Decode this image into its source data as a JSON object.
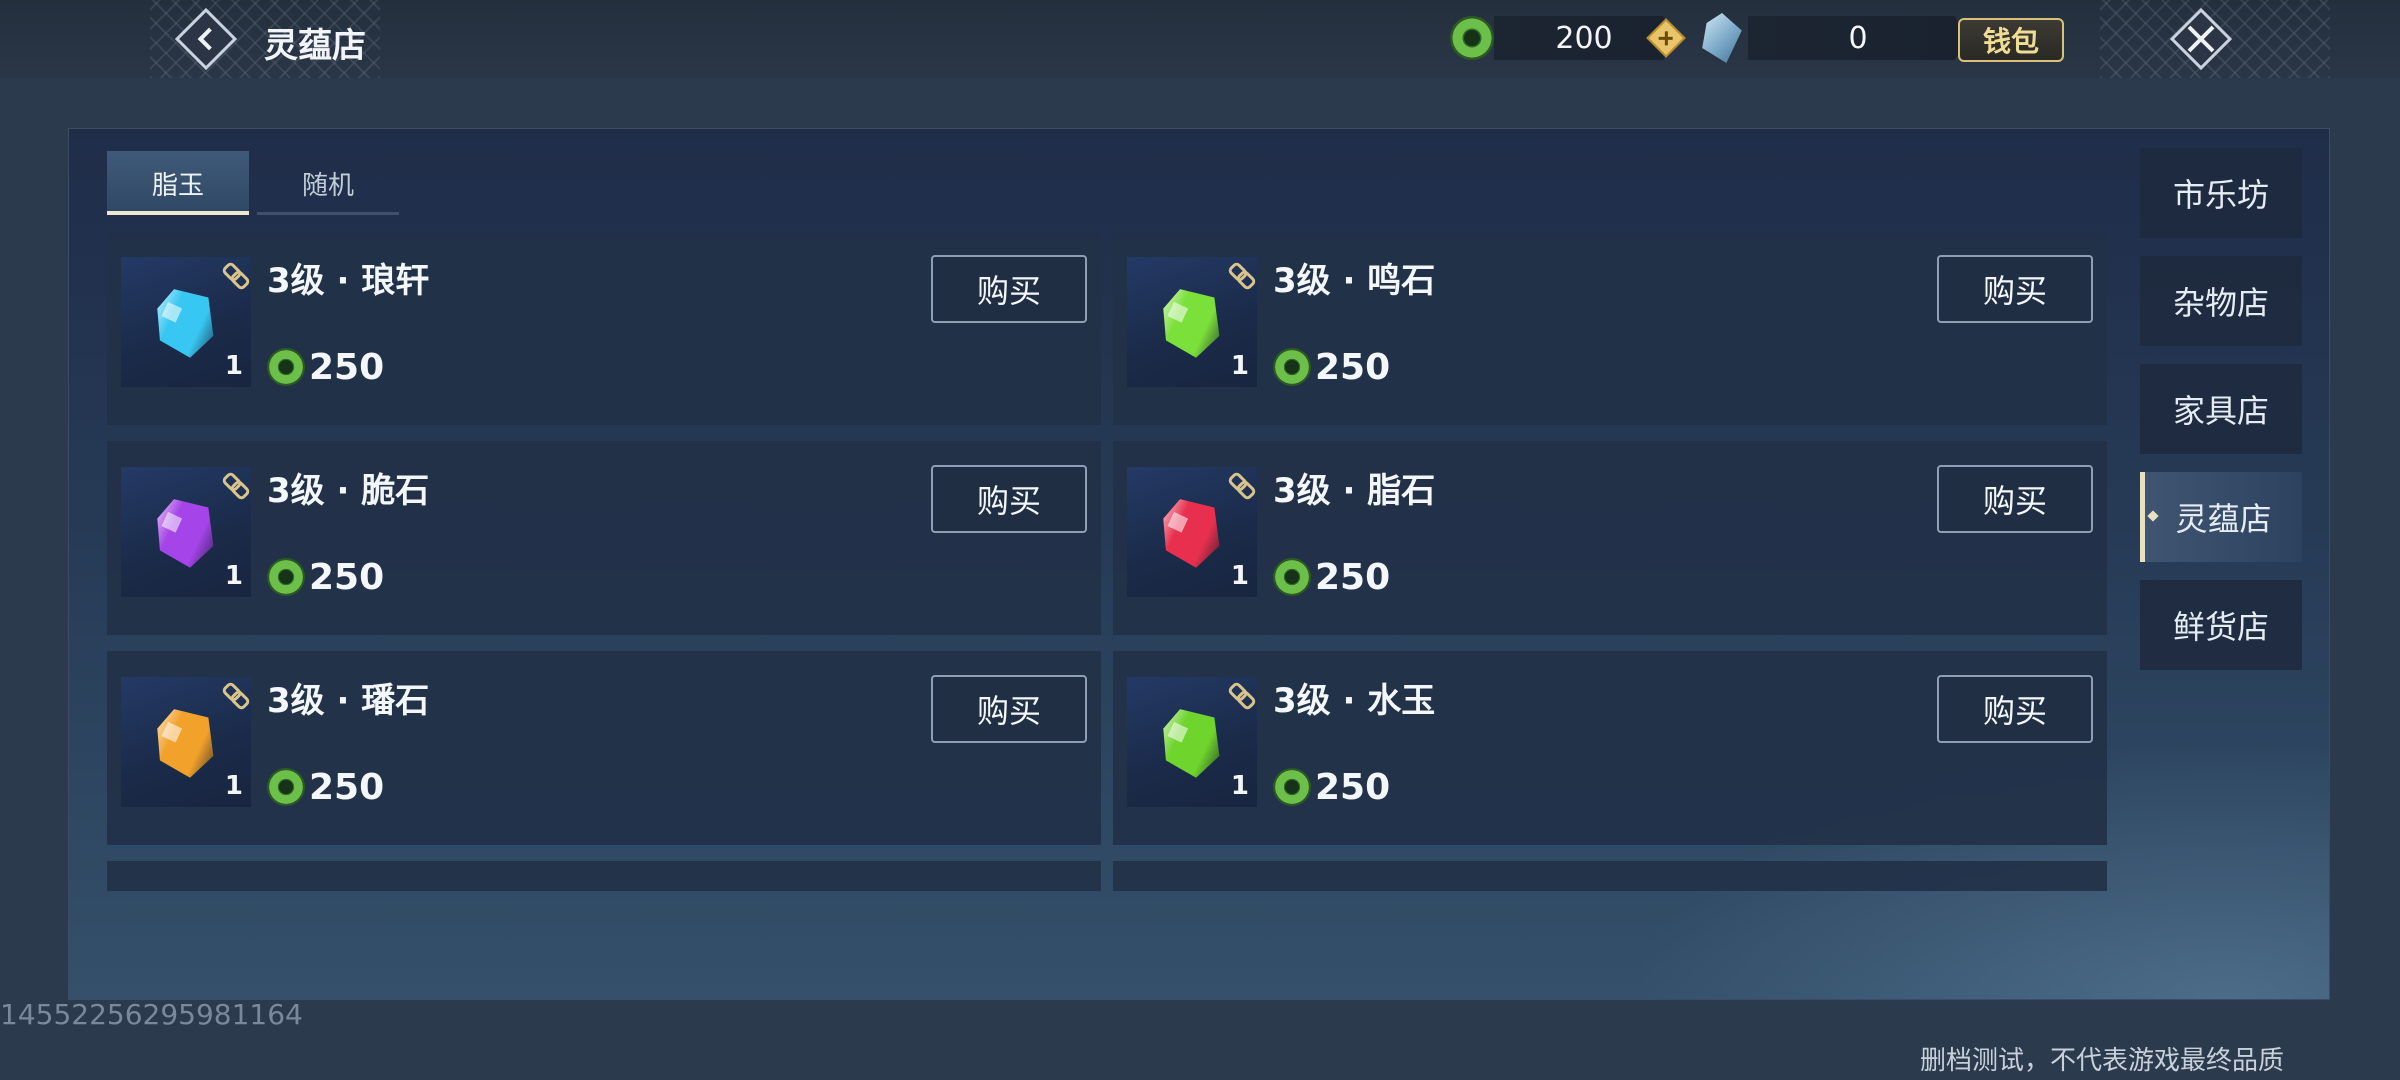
{
  "header": {
    "title": "灵蕴店",
    "currency_primary": {
      "icon": "green-coin-icon",
      "value": "200"
    },
    "currency_secondary": {
      "icon": "blue-crystal-icon",
      "value": "0"
    },
    "wallet_label": "钱包"
  },
  "tabs": [
    {
      "label": "脂玉",
      "active": true
    },
    {
      "label": "随机",
      "active": false
    }
  ],
  "items": [
    {
      "name": "3级 · 琅轩",
      "qty": "1",
      "price": "250",
      "buy_label": "购买",
      "gem_color": "#38c7f2"
    },
    {
      "name": "3级 · 鸣石",
      "qty": "1",
      "price": "250",
      "buy_label": "购买",
      "gem_color": "#7be03a"
    },
    {
      "name": "3级 · 脆石",
      "qty": "1",
      "price": "250",
      "buy_label": "购买",
      "gem_color": "#a544e8"
    },
    {
      "name": "3级 · 脂石",
      "qty": "1",
      "price": "250",
      "buy_label": "购买",
      "gem_color": "#e8304e"
    },
    {
      "name": "3级 · 璠石",
      "qty": "1",
      "price": "250",
      "buy_label": "购买",
      "gem_color": "#f2a12a"
    },
    {
      "name": "3级 · 水玉",
      "qty": "1",
      "price": "250",
      "buy_label": "购买",
      "gem_color": "#6fd42c"
    }
  ],
  "shops": [
    {
      "label": "市乐坊",
      "active": false
    },
    {
      "label": "杂物店",
      "active": false
    },
    {
      "label": "家具店",
      "active": false
    },
    {
      "label": "灵蕴店",
      "active": true
    },
    {
      "label": "鲜货店",
      "active": false
    }
  ],
  "footer": {
    "id_watermark": "14552256295981164",
    "disclaimer": "删档测试，不代表游戏最终品质"
  },
  "colors": {
    "accent": "#e8e0bf",
    "wallet_gold": "#f0dc95"
  }
}
